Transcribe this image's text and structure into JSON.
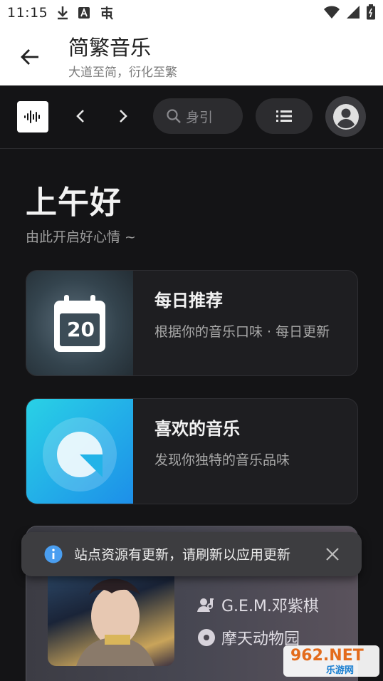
{
  "status_bar": {
    "time": "11:15",
    "icons": [
      "download-icon",
      "font-a-icon",
      "app-notification-icon",
      "wifi-icon",
      "cell-signal-icon",
      "battery-icon"
    ]
  },
  "app_bar": {
    "title": "简繁音乐",
    "subtitle": "大道至简，衍化至繁"
  },
  "toolbar": {
    "search_placeholder": "身引"
  },
  "greeting": {
    "title": "上午好",
    "subtitle": "由此开启好心情 ~"
  },
  "cards": [
    {
      "title": "每日推荐",
      "description": "根据你的音乐口味 · 每日更新",
      "icon_text": "20"
    },
    {
      "title": "喜欢的音乐",
      "description": "发现你独特的音乐品味"
    }
  ],
  "now_playing": {
    "artist": "G.E.M.邓紫棋",
    "album": "摩天动物园"
  },
  "toast": {
    "message": "站点资源有更新，请刷新以应用更新"
  },
  "watermark": {
    "brand": "962.NET",
    "site": "乐游网"
  },
  "colors": {
    "background": "#141416",
    "card": "#1e1e21",
    "accent_cyan": "#29d1e6",
    "accent_blue": "#1d8fe9"
  }
}
